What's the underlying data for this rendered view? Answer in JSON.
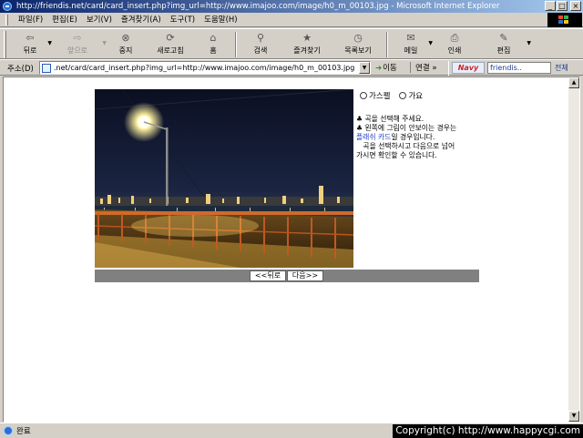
{
  "window": {
    "title": "http://friendis.net/card/card_insert.php?img_url=http://www.imajoo.com/image/h0_m_00103.jpg - Microsoft Internet Explorer",
    "minimize": "_",
    "maximize": "□",
    "close": "×"
  },
  "menu": {
    "items": [
      "파일(F)",
      "편집(E)",
      "보기(V)",
      "즐겨찾기(A)",
      "도구(T)",
      "도움말(H)"
    ]
  },
  "toolbar": {
    "back": "뒤로",
    "forward": "앞으로",
    "stop": "중지",
    "refresh": "새로고침",
    "home": "홈",
    "search": "검색",
    "favorites": "즐겨찾기",
    "history": "목록보기",
    "mail": "메일",
    "print": "인쇄",
    "edit": "편집"
  },
  "address": {
    "label": "주소(D)",
    "url": ".net/card/card_insert.php?img_url=http://www.imajoo.com/image/h0_m_00103.jpg",
    "go": "이동",
    "links": "연결 »"
  },
  "navy": {
    "logo": "Navy",
    "search": "friendis..",
    "all": "전체"
  },
  "card": {
    "options": [
      "가스펠",
      "가요"
    ],
    "instructions": [
      {
        "text": "♣ 곡을 선택해 주세요."
      },
      {
        "text": "♣ 왼쪽에 그림이 안보이는 경우는"
      },
      {
        "link": "플래쉬 카드",
        "text": "일 경우입니다."
      },
      {
        "text": "   곡을 선택하시고 다음으로 넘어"
      },
      {
        "text": "가시면 확인할 수 있습니다."
      }
    ],
    "back_button": "<<뒤로",
    "next_button": "다음>>"
  },
  "status": {
    "text": "완료",
    "copyright": "Copyright(c) http://www.happycgi.com"
  },
  "colors": {
    "titlebar_start": "#0a246a",
    "titlebar_end": "#a6caf0",
    "chrome": "#d4d0c8",
    "nav_strip": "#808080",
    "link": "#1f3fbf"
  }
}
